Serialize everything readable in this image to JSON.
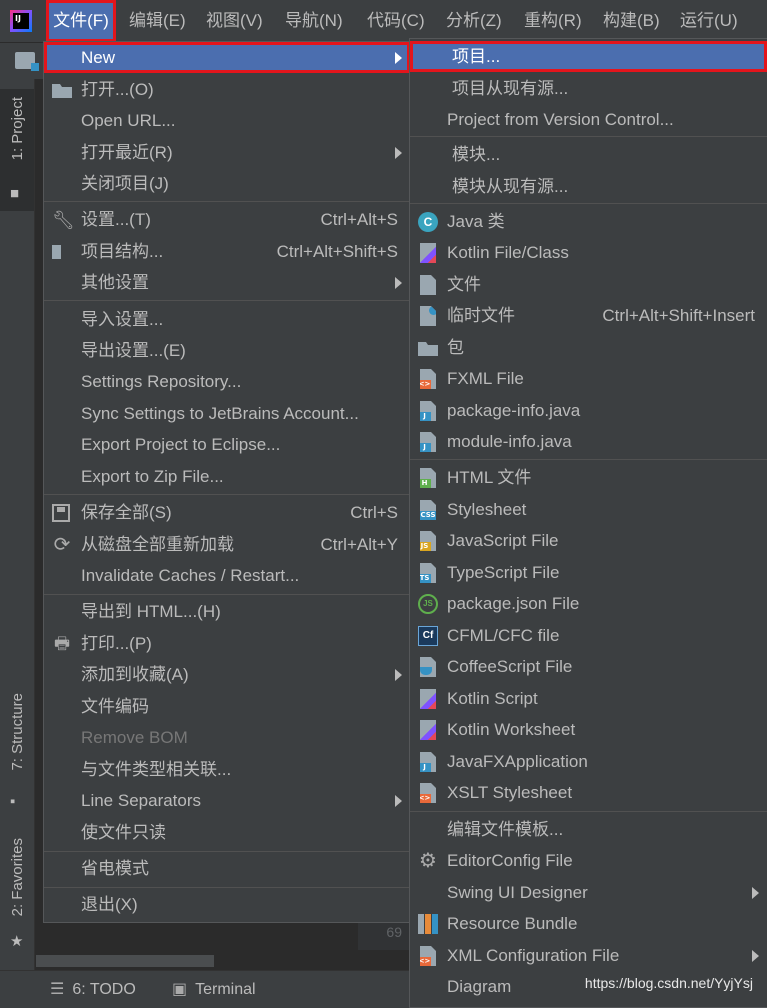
{
  "menubar": {
    "items": [
      "文件(F)",
      "编辑(E)",
      "视图(V)",
      "导航(N)",
      "代码(C)",
      "分析(Z)",
      "重构(R)",
      "构建(B)",
      "运行(U)"
    ]
  },
  "app_logo": {
    "text": "IJ"
  },
  "left_tabs": {
    "project": "1: Project",
    "structure": "7: Structure",
    "favorites": "2: Favorites"
  },
  "editor": {
    "line_number": "69"
  },
  "bottombar": {
    "todo": "6: TODO",
    "terminal": "Terminal"
  },
  "file_menu": {
    "new": "New",
    "open": "打开...(O)",
    "open_url": "Open URL...",
    "open_recent": "打开最近(R)",
    "close_project": "关闭项目(J)",
    "settings": "设置...(T)",
    "settings_sc": "Ctrl+Alt+S",
    "project_structure": "项目结构...",
    "project_structure_sc": "Ctrl+Alt+Shift+S",
    "other_settings": "其他设置",
    "import_settings": "导入设置...",
    "export_settings": "导出设置...(E)",
    "settings_repo": "Settings Repository...",
    "sync_settings": "Sync Settings to JetBrains Account...",
    "export_eclipse": "Export Project to Eclipse...",
    "export_zip": "Export to Zip File...",
    "save_all": "保存全部(S)",
    "save_all_sc": "Ctrl+S",
    "reload_disk": "从磁盘全部重新加载",
    "reload_disk_sc": "Ctrl+Alt+Y",
    "invalidate": "Invalidate Caches / Restart...",
    "export_html": "导出到 HTML...(H)",
    "print": "打印...(P)",
    "add_favorites": "添加到收藏(A)",
    "file_encoding": "文件编码",
    "remove_bom": "Remove BOM",
    "assoc_file_type": "与文件类型相关联...",
    "line_separators": "Line Separators",
    "make_readonly": "使文件只读",
    "power_save": "省电模式",
    "exit": "退出(X)"
  },
  "new_menu": {
    "project": "项目...",
    "project_existing": "项目从现有源...",
    "project_vcs": "Project from Version Control...",
    "module": "模块...",
    "module_existing": "模块从现有源...",
    "java_class": "Java 类",
    "kotlin_file": "Kotlin File/Class",
    "file": "文件",
    "scratch": "临时文件",
    "scratch_sc": "Ctrl+Alt+Shift+Insert",
    "package": "包",
    "fxml": "FXML File",
    "package_info": "package-info.java",
    "module_info": "module-info.java",
    "html": "HTML 文件",
    "stylesheet": "Stylesheet",
    "javascript": "JavaScript File",
    "typescript": "TypeScript File",
    "package_json": "package.json File",
    "cfml": "CFML/CFC file",
    "coffeescript": "CoffeeScript File",
    "kotlin_script": "Kotlin Script",
    "kotlin_worksheet": "Kotlin Worksheet",
    "javafx": "JavaFXApplication",
    "xslt": "XSLT Stylesheet",
    "edit_templates": "编辑文件模板...",
    "editorconfig": "EditorConfig File",
    "swing": "Swing UI Designer",
    "resource_bundle": "Resource Bundle",
    "xml_config": "XML Configuration File",
    "diagram": "Diagram"
  },
  "icon_tags": {
    "xml": "<>",
    "j": "J",
    "h": "H",
    "css": "CSS",
    "js": "JS",
    "ts": "TS",
    "cf": "Cf",
    "c": "C",
    "json": "JS"
  },
  "watermark": "https://blog.csdn.net/YyjYsj"
}
